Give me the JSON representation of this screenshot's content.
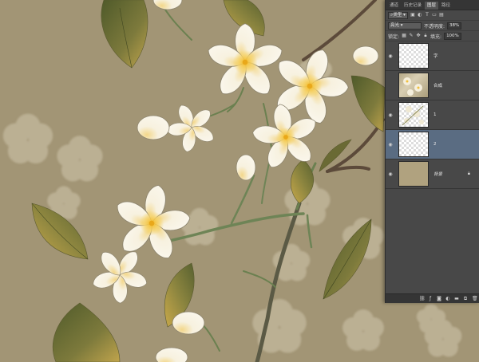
{
  "panel": {
    "tabs": [
      {
        "label": "通道"
      },
      {
        "label": "历史记录"
      },
      {
        "label": "图层"
      },
      {
        "label": "路径"
      }
    ],
    "active_tab_index": 2,
    "filter": {
      "kind_label": "类型"
    },
    "blend_mode": "亮光",
    "opacity_label": "不透明度:",
    "opacity_value": "38%",
    "lock_label": "锁定:",
    "fill_label": "填充:",
    "fill_value": "100%",
    "layers": [
      {
        "name": "字",
        "visible": true,
        "thumb": "transparent"
      },
      {
        "name": "合成",
        "visible": false,
        "thumb": "composite"
      },
      {
        "name": "1",
        "visible": true,
        "thumb": "flowers"
      },
      {
        "name": "2",
        "visible": true,
        "thumb": "transparent",
        "selected": true
      },
      {
        "name": "背景",
        "visible": true,
        "thumb": "background",
        "locked": true
      }
    ],
    "bottom_icons": [
      "link-icon",
      "fx-icon",
      "mask-icon",
      "adjustment-icon",
      "folder-icon",
      "new-layer-icon",
      "trash-icon"
    ]
  },
  "colors": {
    "canvas_bg": "#a59879",
    "petal": "#f6f1e2",
    "petal_stroke": "#8e8670",
    "flower_center": "#f2c23c",
    "leaf_dark": "#6d6a2e",
    "leaf_light": "#b7a24a",
    "branch": "#5c4a3a",
    "stem": "#6b8050",
    "ghost": "#c9bfa4",
    "panel_bg": "#484848",
    "selected_layer": "#5a6c82"
  }
}
